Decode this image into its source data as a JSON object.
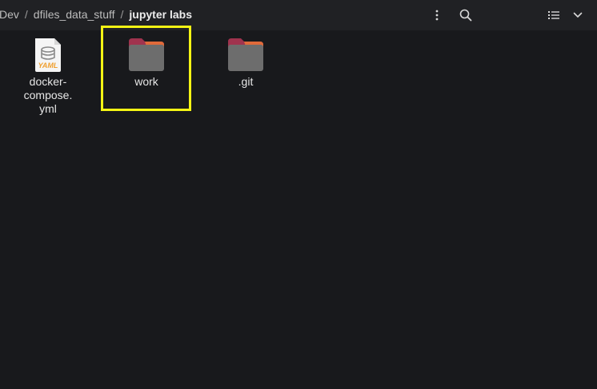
{
  "breadcrumb": {
    "items": [
      "Dev",
      "dfiles_data_stuff",
      "jupyter labs"
    ],
    "separator": "/"
  },
  "toolbar": {
    "menu_icon": "vertical-dots-icon",
    "search_icon": "search-icon",
    "view_icon": "list-view-icon",
    "dropdown_icon": "chevron-down-icon"
  },
  "files": [
    {
      "name": "docker-\ncompose.\nyml",
      "type": "yaml-file",
      "badge": "YAML"
    },
    {
      "name": "work",
      "type": "folder"
    },
    {
      "name": ".git",
      "type": "folder"
    }
  ],
  "colors": {
    "background": "#18191c",
    "header": "#202124",
    "folder_body": "#6d6d6d",
    "folder_tab": "#a0334e",
    "folder_tab_accent": "#e06a3a",
    "selection": "#f4f414",
    "yaml_accent": "#f0a030"
  }
}
